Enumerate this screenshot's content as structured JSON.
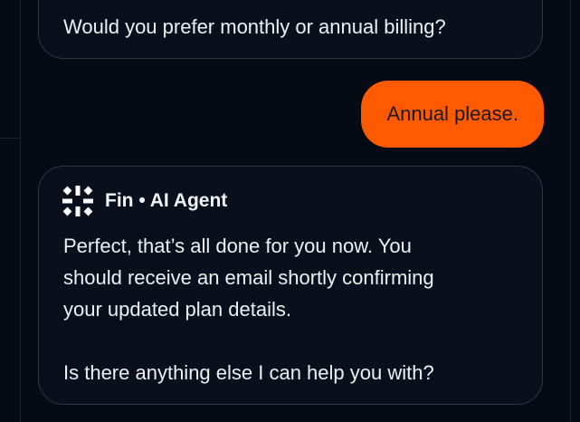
{
  "conversation": {
    "previous_agent_message": "Would you prefer monthly or annual billing?",
    "user_message": "Annual please.",
    "agent": {
      "name": "Fin • AI Agent",
      "icon": "fin-logo-icon",
      "message_lines": [
        "Perfect, that’s all done for you now. You",
        "should receive an email shortly confirming",
        "your updated plan details."
      ],
      "followup": "Is there anything else I can help you with?"
    }
  },
  "colors": {
    "background": "#060a14",
    "user_bubble": "#ff5a00",
    "agent_bubble_border": "#2f3644",
    "text": "#eef0f4"
  }
}
